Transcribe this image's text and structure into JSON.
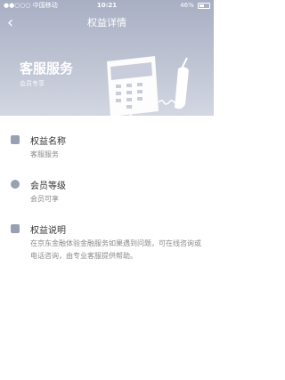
{
  "status_bar": {
    "carrier": "●●○○○ 中国移动",
    "time": "10:21",
    "battery": "46%"
  },
  "nav": {
    "title": "权益详情"
  },
  "hero": {
    "title": "客服服务",
    "subtitle": "会员专享"
  },
  "sections": [
    {
      "title": "权益名称",
      "text": "客服服务",
      "icon": "list-icon"
    },
    {
      "title": "会员等级",
      "text": "会员可享",
      "icon": "compass-icon"
    },
    {
      "title": "权益说明",
      "text": "在京东金融体验金融服务如果遇到问题，可在线咨询或电话咨询，由专业客服提供帮助。",
      "icon": "info-icon"
    }
  ]
}
